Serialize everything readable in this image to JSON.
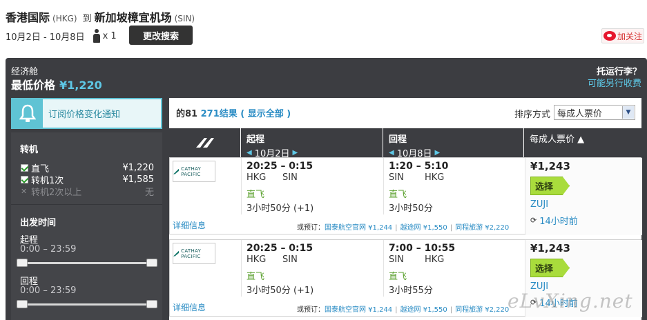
{
  "header": {
    "origin_city": "香港国际",
    "origin_code": "(HKG)",
    "to_word": "到",
    "dest_city": "新加坡樟宜机场",
    "dest_code": "(SIN)",
    "dates": "10月2日 - 10月8日",
    "passengers": "x 1",
    "modify_button": "更改搜索",
    "follow_button": "加关注"
  },
  "summary": {
    "cabin": "经济舱",
    "lowest_label": "最低价格",
    "lowest_price": "¥1,220",
    "baggage_question": "托运行李？",
    "baggage_note": "可能另行收费"
  },
  "subscribe": {
    "label": "订阅价格变化通知"
  },
  "filters": {
    "stops_title": "转机",
    "stops": [
      {
        "label": "直飞",
        "price": "¥1,220",
        "checked": true
      },
      {
        "label": "转机1次",
        "price": "¥1,585",
        "checked": true
      },
      {
        "label": "转机2次以上",
        "price": "无",
        "checked": false
      }
    ],
    "time_title": "出发时间",
    "outbound_label": "起程",
    "outbound_range": "0:00 – 23:59",
    "return_label": "回程",
    "return_range": "0:00 – 23:59"
  },
  "results": {
    "count_prefix": "的81",
    "count_link": "271结果",
    "show_all": "( 显示全部 )",
    "sort_label": "排序方式",
    "sort_value": "每成人票价",
    "columns": {
      "outbound": "起程",
      "outbound_date": "10月2日",
      "return": "回程",
      "return_date": "10月8日",
      "price": "每成人票价 ▲"
    }
  },
  "flights": [
    {
      "airline": "CATHAY PACIFIC",
      "out_time": "20:25 – 0:15",
      "out_from": "HKG",
      "out_to": "SIN",
      "out_stops": "直飞",
      "out_duration": "3小时50分 (+1)",
      "ret_time": "1:20 – 5:10",
      "ret_from": "SIN",
      "ret_to": "HKG",
      "ret_stops": "直飞",
      "ret_duration": "3小时50分",
      "price": "¥1,243",
      "select": "选择",
      "source": "ZUJI",
      "updated": "14小时前",
      "details": "详细信息",
      "alt_prefix": "或预订：",
      "alt": [
        "国泰航空官网 ¥1,244",
        "越途网 ¥1,550",
        "同程旅游 ¥2,220"
      ]
    },
    {
      "airline": "CATHAY PACIFIC",
      "out_time": "20:25 – 0:15",
      "out_from": "HKG",
      "out_to": "SIN",
      "out_stops": "直飞",
      "out_duration": "3小时50分 (+1)",
      "ret_time": "7:00 – 10:55",
      "ret_from": "SIN",
      "ret_to": "HKG",
      "ret_stops": "直飞",
      "ret_duration": "3小时55分",
      "price": "¥1,243",
      "select": "选择",
      "source": "ZUJI",
      "updated": "14小时前",
      "details": "详细信息",
      "alt_prefix": "或预订：",
      "alt": [
        "国泰航空官网 ¥1,244",
        "越途网 ¥1,550",
        "同程旅游 ¥2,220"
      ]
    }
  ],
  "watermark": "eLvXing.net"
}
